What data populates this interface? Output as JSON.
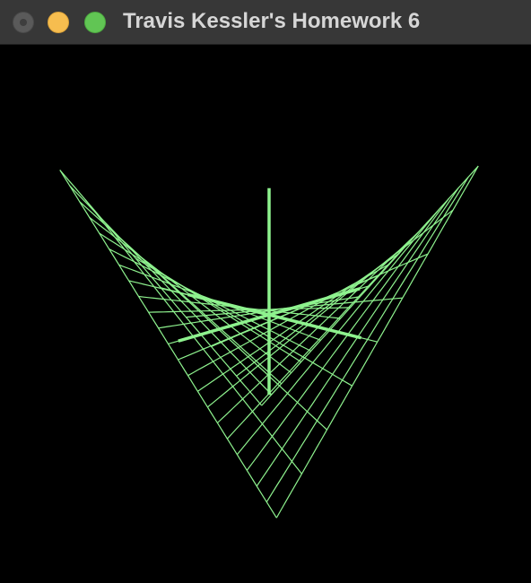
{
  "window": {
    "title": "Travis Kessler's Homework 6",
    "controls": {
      "close": "close-button",
      "minimize": "minimize-button",
      "zoom": "zoom-button"
    },
    "colors": {
      "titlebar": "#373737",
      "title_text": "#d6d6d6",
      "close": "#5a5a5a",
      "minimize": "#f6bd4f",
      "zoom": "#61c554"
    }
  },
  "scene": {
    "description_free": true,
    "background": "#000000",
    "wire_color": "#8ef28e",
    "surface": "hyperbolic-paraboloid-wireframe",
    "axes": [
      "x-axis",
      "y-axis",
      "z-axis"
    ]
  }
}
